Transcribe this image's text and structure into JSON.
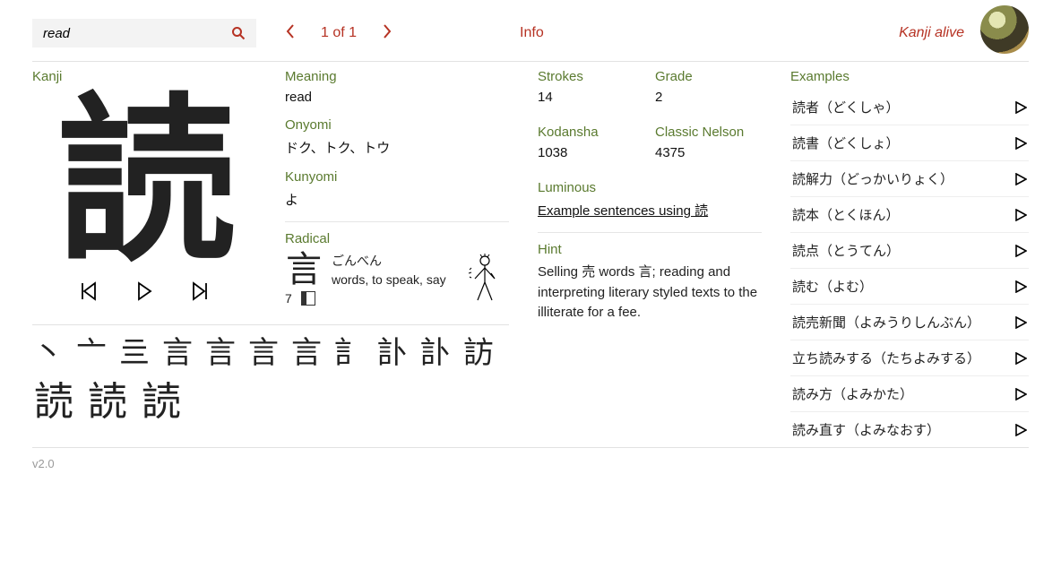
{
  "search": {
    "value": "read"
  },
  "pager": {
    "text": "1 of 1"
  },
  "topbar": {
    "info": "Info",
    "brand": "Kanji alive"
  },
  "labels": {
    "kanji": "Kanji",
    "meaning": "Meaning",
    "onyomi": "Onyomi",
    "kunyomi": "Kunyomi",
    "radical": "Radical",
    "strokes": "Strokes",
    "grade": "Grade",
    "kodansha": "Kodansha",
    "nelson": "Classic Nelson",
    "luminous": "Luminous",
    "hint": "Hint",
    "examples": "Examples"
  },
  "kanji": {
    "glyph": "読",
    "meaning": "read",
    "onyomi": "ドク、トク、トウ",
    "kunyomi": "よ",
    "strokes": "14",
    "grade": "2",
    "kodansha": "1038",
    "nelson": "4375",
    "luminous_text": "Example sentences using 読",
    "hint": "Selling 売 words 言; reading and interpreting literary styled texts to the illiterate for a fee."
  },
  "radical": {
    "glyph": "言",
    "name_ja": "ごんべん",
    "meaning": "words, to speak, say",
    "strokes": "7"
  },
  "examples": [
    "読者（どくしゃ）",
    "読書（どくしょ）",
    "読解力（どっかいりょく）",
    "読本（とくほん）",
    "読点（とうてん）",
    "読む（よむ）",
    "読売新聞（よみうりしんぶん）",
    "立ち読みする（たちよみする）",
    "読み方（よみかた）",
    "読み直す（よみなおす）"
  ],
  "stroke_order": {
    "row1": [
      "丶",
      "亠",
      "亖",
      "言",
      "言",
      "言",
      "言",
      "訁",
      "訃",
      "訃",
      "訪"
    ],
    "row2": [
      "読",
      "読",
      "読"
    ]
  },
  "footer": {
    "version": "v2.0"
  }
}
